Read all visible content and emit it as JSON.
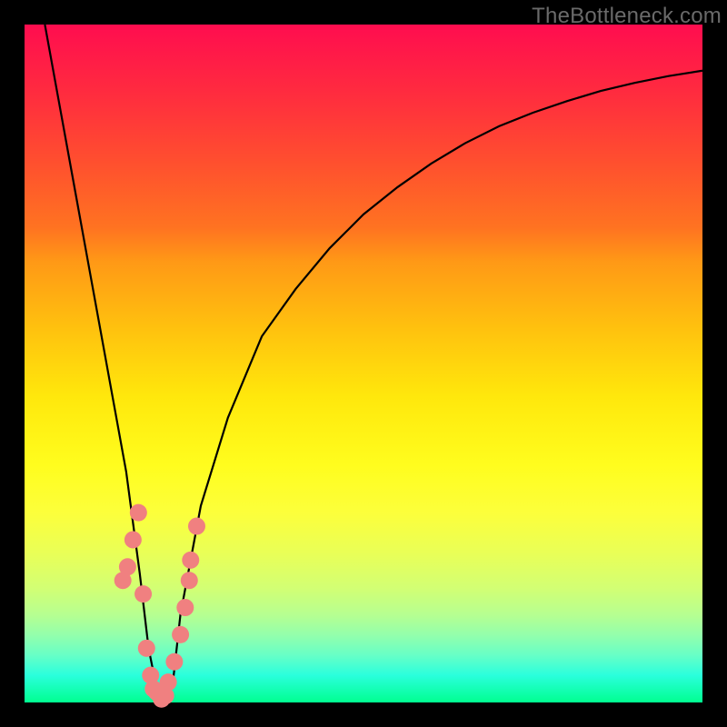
{
  "watermark": "TheBottleneck.com",
  "colors": {
    "curve_stroke": "#000000",
    "marker_fill": "#f08080",
    "background_frame": "#000000"
  },
  "chart_data": {
    "type": "line",
    "title": "",
    "xlabel": "",
    "ylabel": "",
    "xlim": [
      0,
      100
    ],
    "ylim": [
      0,
      100
    ],
    "series": [
      {
        "name": "bottleneck-curve",
        "x": [
          3,
          5,
          7,
          9,
          11,
          13,
          15,
          17,
          18.3,
          19.5,
          20.8,
          22,
          23,
          26,
          30,
          35,
          40,
          45,
          50,
          55,
          60,
          65,
          70,
          75,
          80,
          85,
          90,
          95,
          100
        ],
        "y": [
          100,
          89,
          78,
          67,
          56,
          45,
          34,
          19,
          8,
          2,
          0.5,
          4,
          13,
          29,
          42,
          54,
          61,
          67,
          72,
          76,
          79.5,
          82.5,
          85,
          87,
          88.7,
          90.2,
          91.4,
          92.4,
          93.2
        ]
      }
    ],
    "markers": [
      {
        "x": 14.5,
        "y": 18
      },
      {
        "x": 15.2,
        "y": 20
      },
      {
        "x": 16.0,
        "y": 24
      },
      {
        "x": 16.8,
        "y": 28
      },
      {
        "x": 17.5,
        "y": 16
      },
      {
        "x": 18.0,
        "y": 8
      },
      {
        "x": 18.6,
        "y": 4
      },
      {
        "x": 19.5,
        "y": 1.5
      },
      {
        "x": 20.2,
        "y": 0.5
      },
      {
        "x": 21.2,
        "y": 3
      },
      {
        "x": 22.1,
        "y": 6
      },
      {
        "x": 23.0,
        "y": 10
      },
      {
        "x": 23.7,
        "y": 14
      },
      {
        "x": 24.3,
        "y": 18
      },
      {
        "x": 24.5,
        "y": 21
      },
      {
        "x": 25.4,
        "y": 26
      },
      {
        "x": 19.0,
        "y": 2
      },
      {
        "x": 20.8,
        "y": 1
      }
    ]
  }
}
